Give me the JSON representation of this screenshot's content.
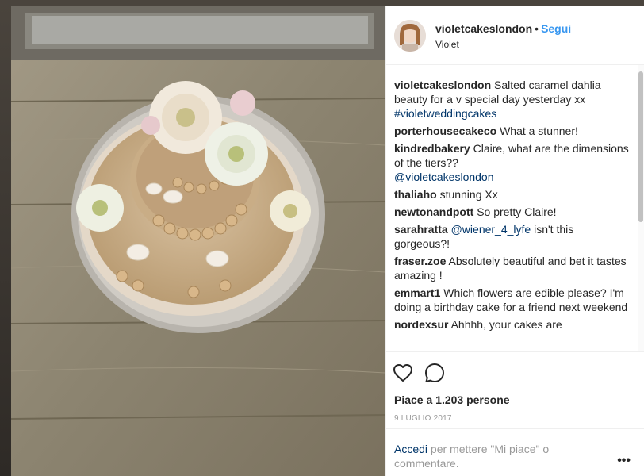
{
  "header": {
    "username": "violetcakeslondon",
    "separator": "•",
    "follow_label": "Segui",
    "full_name": "Violet"
  },
  "comments": [
    {
      "user": "violetcakeslondon",
      "text": "Salted caramel dahlia beauty for a v special day yesterday xx",
      "link": "#violetweddingcakes"
    },
    {
      "user": "porterhousecakeco",
      "text": "What a stunner!"
    },
    {
      "user": "kindredbakery",
      "text": "Claire, what are the dimensions of the tiers??",
      "link": "@violetcakeslondon"
    },
    {
      "user": "thaliaho",
      "text": "stunning Xx"
    },
    {
      "user": "newtonandpott",
      "text": "So pretty Claire!"
    },
    {
      "user": "sarahratta",
      "link": "@wiener_4_lyfe",
      "text": "isn't this gorgeous?!"
    },
    {
      "user": "fraser.zoe",
      "text": "Absolutely beautiful and bet it tastes amazing !"
    },
    {
      "user": "emmart1",
      "text": "Which flowers are edible please? I'm doing a birthday cake for a friend next weekend"
    },
    {
      "user": "nordexsur",
      "text": "Ahhhh, your cakes are"
    }
  ],
  "actions": {
    "likes_text": "Piace a 1.203 persone",
    "date": "9 LUGLIO 2017",
    "login_link": "Accedi",
    "login_text": "per mettere \"Mi piace\" o commentare.",
    "more_label": "•••"
  },
  "icons": [
    "heart-icon",
    "comment-icon"
  ],
  "colors": {
    "accent_blue": "#3897f0",
    "link_blue": "#003569",
    "muted_gray": "#999999"
  }
}
